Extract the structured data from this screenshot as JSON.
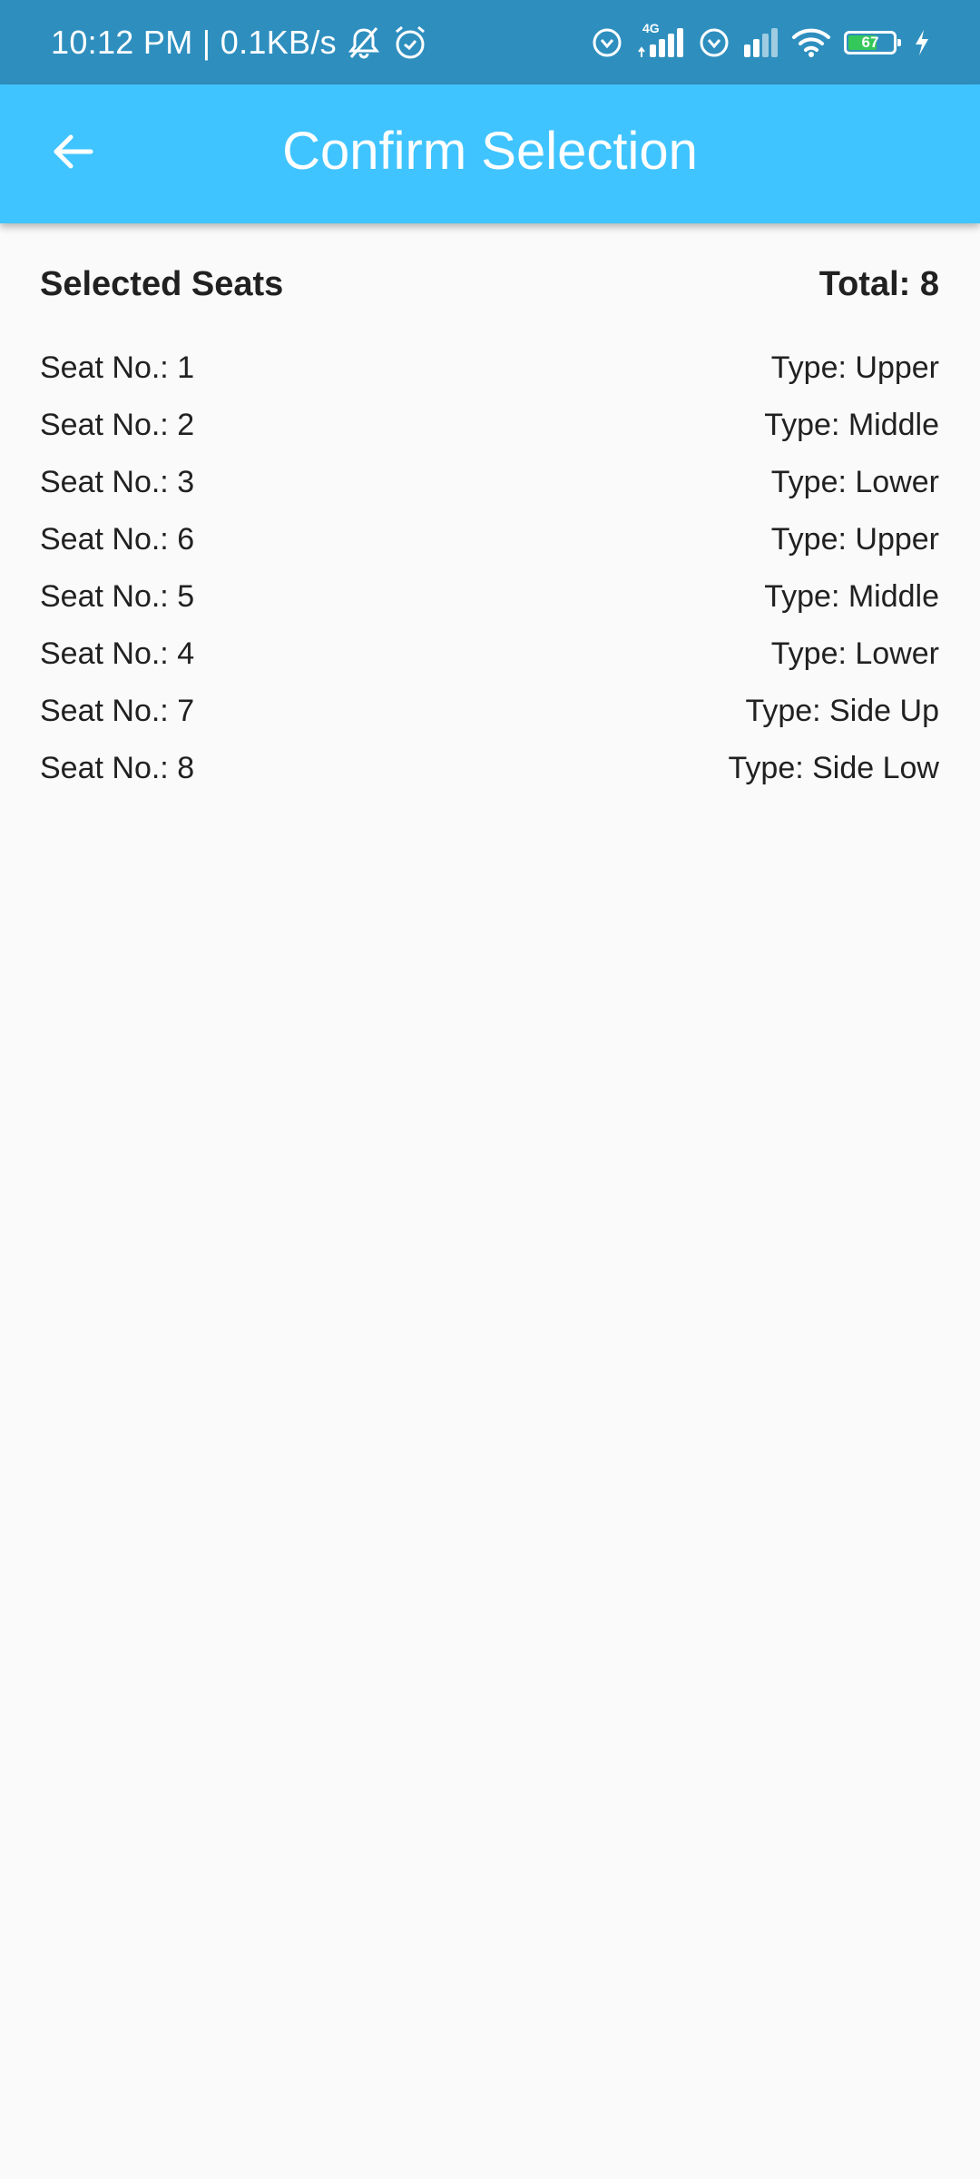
{
  "status_bar": {
    "time_speed": "10:12 PM | 0.1KB/s",
    "network_label": "4G",
    "battery_level": "67",
    "battery_fraction": 0.67,
    "icons": [
      "mute-icon",
      "alarm-icon",
      "vpn-icon",
      "signal-icon",
      "wifi-icon",
      "battery-icon",
      "charging-icon"
    ]
  },
  "app_bar": {
    "title": "Confirm Selection",
    "back_icon": "arrow-back-icon",
    "color": "#40c4ff"
  },
  "summary": {
    "heading": "Selected Seats",
    "total": "Total: 8"
  },
  "seats": [
    {
      "seat": "Seat No.: 1",
      "type": "Type: Upper"
    },
    {
      "seat": "Seat No.: 2",
      "type": "Type: Middle"
    },
    {
      "seat": "Seat No.: 3",
      "type": "Type: Lower"
    },
    {
      "seat": "Seat No.: 6",
      "type": "Type: Upper"
    },
    {
      "seat": "Seat No.: 5",
      "type": "Type: Middle"
    },
    {
      "seat": "Seat No.: 4",
      "type": "Type: Lower"
    },
    {
      "seat": "Seat No.: 7",
      "type": "Type: Side Up"
    },
    {
      "seat": "Seat No.: 8",
      "type": "Type: Side Low"
    }
  ]
}
